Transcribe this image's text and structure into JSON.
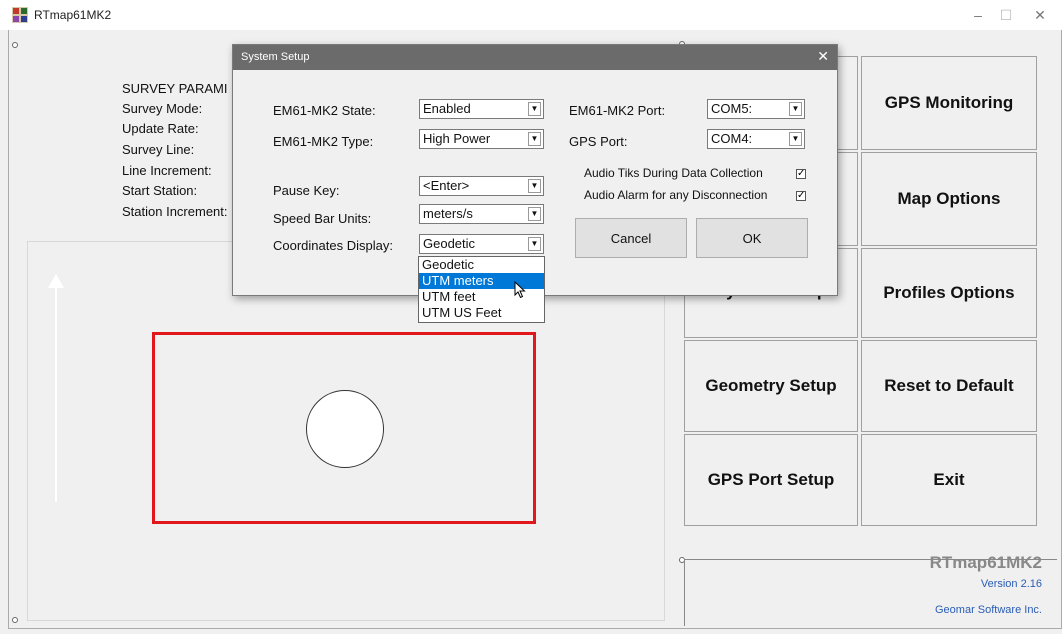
{
  "window": {
    "title": "RTmap61MK2",
    "minimize": "–",
    "maximize": "☐",
    "close": "✕"
  },
  "survey": {
    "heading": "SURVEY PARAMI",
    "labels": [
      "Survey Mode:",
      "Update Rate:",
      "Survey Line:",
      "Line Increment:",
      "Start Station:",
      "Station Increment:"
    ]
  },
  "buttons": {
    "top_left_partial": "",
    "gps_monitoring": "GPS Monitoring",
    "map_options": "Map Options",
    "system_setup_partial": "System Setup",
    "profiles_options": "Profiles Options",
    "geometry_setup": "Geometry Setup",
    "reset_default": "Reset to Default",
    "gps_port_setup": "GPS Port Setup",
    "exit": "Exit"
  },
  "brand": {
    "name": "RTmap61MK2",
    "version": "Version 2.16",
    "company": "Geomar Software Inc."
  },
  "dialog": {
    "title": "System Setup",
    "close": "✕",
    "state_label": "EM61-MK2 State:",
    "state_value": "Enabled",
    "type_label": "EM61-MK2 Type:",
    "type_value": "High Power",
    "pause_label": "Pause Key:",
    "pause_value": "<Enter>",
    "speed_label": "Speed Bar Units:",
    "speed_value": "meters/s",
    "coord_label": "Coordinates Display:",
    "coord_value": "Geodetic",
    "port_label": "EM61-MK2 Port:",
    "port_value": "COM5:",
    "gps_port_label": "GPS Port:",
    "gps_port_value": "COM4:",
    "audio_tiks": "Audio Tiks During Data Collection",
    "audio_alarm": "Audio Alarm for any Disconnection",
    "check_mark": "✓",
    "arrow": "▼",
    "cancel": "Cancel",
    "ok": "OK",
    "coord_options": [
      "Geodetic",
      "UTM meters",
      "UTM feet",
      "UTM US Feet"
    ],
    "coord_selected_index": 1
  }
}
